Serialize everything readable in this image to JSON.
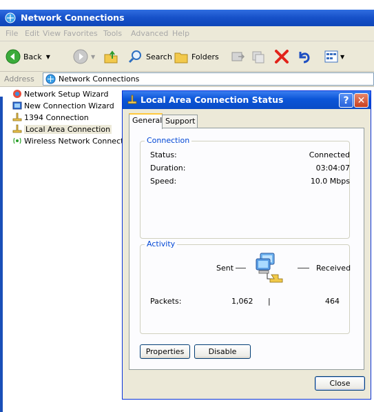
{
  "explorer": {
    "title": "Network Connections",
    "menu": [
      "File",
      "Edit",
      "View",
      "Favorites",
      "Tools",
      "Advanced",
      "Help"
    ],
    "toolbar": {
      "back": "Back",
      "search": "Search",
      "folders": "Folders"
    },
    "address": {
      "label": "Address",
      "value": "Network Connections"
    },
    "items": [
      {
        "label": "Network Setup Wizard",
        "icon": "setup-wizard-icon"
      },
      {
        "label": "New Connection Wizard",
        "icon": "new-connection-wizard-icon"
      },
      {
        "label": "1394 Connection",
        "icon": "lan-connection-icon"
      },
      {
        "label": "Local Area Connection",
        "icon": "lan-connection-icon",
        "selected": true
      },
      {
        "label": "Wireless Network Connection",
        "icon": "wireless-connection-icon"
      }
    ]
  },
  "dialog": {
    "title": "Local Area Connection Status",
    "help_glyph": "?",
    "close_glyph": "✕",
    "tabs": [
      "General",
      "Support"
    ],
    "connection": {
      "group_title": "Connection",
      "status_label": "Status:",
      "status_value": "Connected",
      "duration_label": "Duration:",
      "duration_value": "03:04:07",
      "speed_label": "Speed:",
      "speed_value": "10.0 Mbps"
    },
    "activity": {
      "group_title": "Activity",
      "sent_label": "Sent",
      "received_label": "Received",
      "packets_label": "Packets:",
      "packets_sent": "1,062",
      "packets_received": "464",
      "separator": "|"
    },
    "buttons": {
      "properties": "Properties",
      "disable": "Disable",
      "close": "Close"
    }
  }
}
